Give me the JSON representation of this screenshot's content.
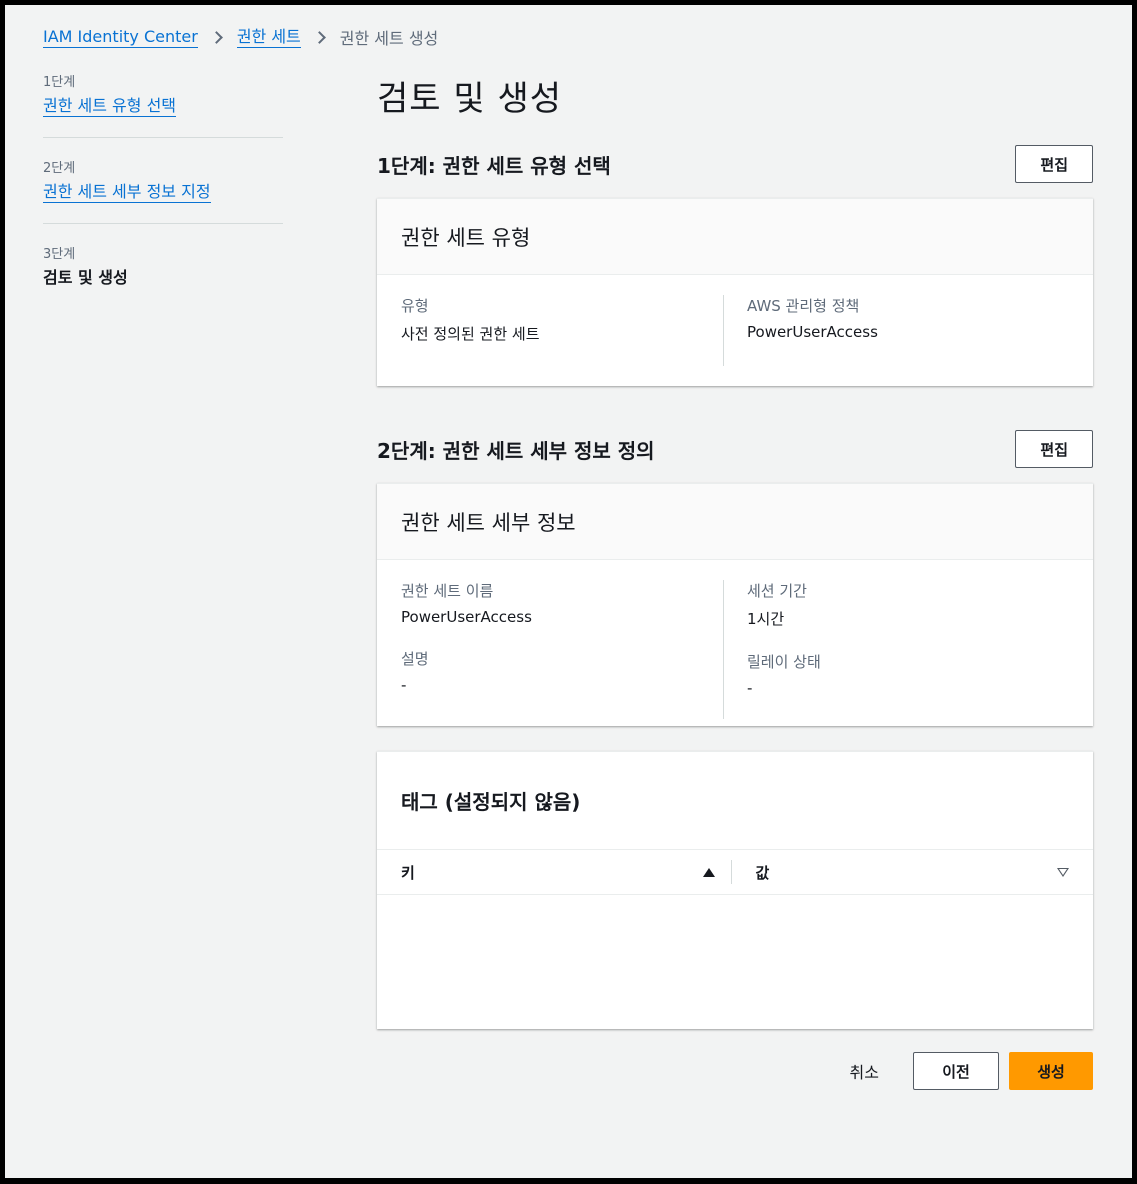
{
  "breadcrumb": {
    "items": [
      "IAM Identity Center",
      "권한 세트"
    ],
    "current": "권한 세트 생성"
  },
  "steps": [
    {
      "num": "1단계",
      "label": "권한 세트 유형 선택"
    },
    {
      "num": "2단계",
      "label": "권한 세트 세부 정보 지정"
    },
    {
      "num": "3단계",
      "label": "검토 및 생성"
    }
  ],
  "main": {
    "title": "검토 및 생성",
    "section1": {
      "title": "1단계: 권한 세트 유형 선택",
      "edit_label": "편집",
      "card_title": "권한 세트 유형",
      "fields": [
        {
          "label": "유형",
          "value": "사전 정의된 권한 세트"
        },
        {
          "label": "AWS 관리형 정책",
          "value": "PowerUserAccess"
        }
      ]
    },
    "section2": {
      "title": "2단계: 권한 세트 세부 정보 정의",
      "edit_label": "편집",
      "card_title": "권한 세트 세부 정보",
      "left": [
        {
          "label": "권한 세트 이름",
          "value": "PowerUserAccess"
        },
        {
          "label": "설명",
          "value": "-"
        }
      ],
      "right": [
        {
          "label": "세션 기간",
          "value": "1시간"
        },
        {
          "label": "릴레이 상태",
          "value": "-"
        }
      ]
    },
    "tags": {
      "title": "태그 (설정되지 않음)",
      "columns": [
        "키",
        "값"
      ]
    }
  },
  "footer": {
    "cancel_label": "취소",
    "prev_label": "이전",
    "create_label": "생성"
  },
  "colors": {
    "link": "#0972d3",
    "primary": "#ff9900",
    "background": "#f2f3f3"
  }
}
